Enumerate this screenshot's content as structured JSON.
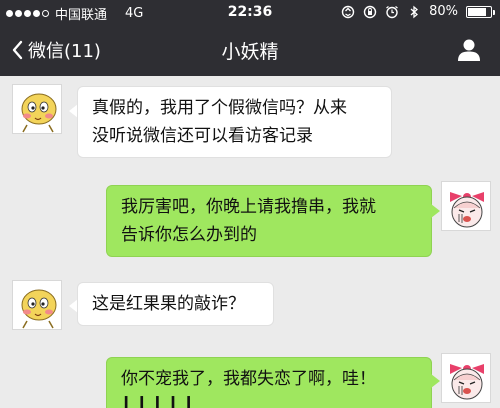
{
  "status_bar": {
    "carrier": "中国联通",
    "network": "4G",
    "time": "22:36",
    "battery": "80%",
    "battery_level": 0.8,
    "icons": [
      "sync-icon",
      "orientation-lock-icon",
      "alarm-icon",
      "bluetooth-icon"
    ]
  },
  "nav": {
    "back_label": "微信(11)",
    "title": "小妖精",
    "profile_icon": "person-icon"
  },
  "messages": [
    {
      "side": "in",
      "lines": [
        "真假的，我用了个假微信吗？从来",
        "没听说微信还可以看访客记录"
      ],
      "avatar": "yellow-cartoon-avatar"
    },
    {
      "side": "out",
      "lines": [
        "我厉害吧，你晚上请我撸串，我就",
        "告诉你怎么办到的"
      ],
      "avatar": "pink-bow-cartoon-avatar"
    },
    {
      "side": "in",
      "lines": [
        "这是红果果的敲诈？"
      ],
      "avatar": "yellow-cartoon-avatar"
    },
    {
      "side": "out",
      "lines": [
        "你不宠我了，我都失恋了啊，哇！",
        "┃ ┃ ┃ ┃ ┃"
      ],
      "avatar": "pink-bow-cartoon-avatar"
    }
  ],
  "colors": {
    "bar_bg": "#2e2e33",
    "chat_bg": "#ebebeb",
    "out_bubble": "#9fe75f",
    "in_bubble": "#ffffff"
  }
}
